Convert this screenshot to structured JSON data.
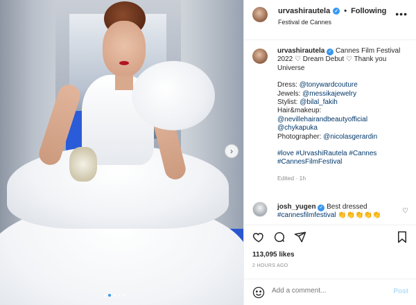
{
  "post": {
    "username": "urvashirautela",
    "follow_status": "Following",
    "location": "Festival de Cannes",
    "more_icon": "more-horizontal-icon"
  },
  "caption": {
    "username": "urvashirautela",
    "line1": "Cannes Film Festival 2022 ♡ Dream Debut ♡ Thank you Universe",
    "dress_label": "Dress:",
    "dress_handle": "@tonywardcouture",
    "jewels_label": "Jewels:",
    "jewels_handle": "@messikajewelry",
    "stylist_label": "Stylist:",
    "stylist_handle": "@bilal_fakih",
    "hair_label": "Hair&makeup:",
    "hair_handle1": "@nevillehairandbeautyofficial",
    "hair_handle2": "@chykapuka",
    "photographer_label": "Photographer:",
    "photographer_handle": "@nicolasgerardin",
    "hashtags": "#love #UrvashiRautela #Cannes #CannesFilmFestival",
    "edited": "Edited · 1h"
  },
  "comment": {
    "username": "josh_yugen",
    "text": "Best dressed",
    "hashtag": "#cannesfilmfestival",
    "emojis": "👏👏👏👏👏"
  },
  "stats": {
    "likes": "113,095 likes",
    "time_ago": "2 HOURS AGO"
  },
  "composer": {
    "placeholder": "Add a comment...",
    "post_label": "Post"
  },
  "carousel": {
    "next_glyph": "›",
    "slide_count": 5,
    "active_slide": 2
  },
  "colors": {
    "verified": "#3897f0",
    "link": "#00376b",
    "post_disabled": "#b2dffc"
  }
}
